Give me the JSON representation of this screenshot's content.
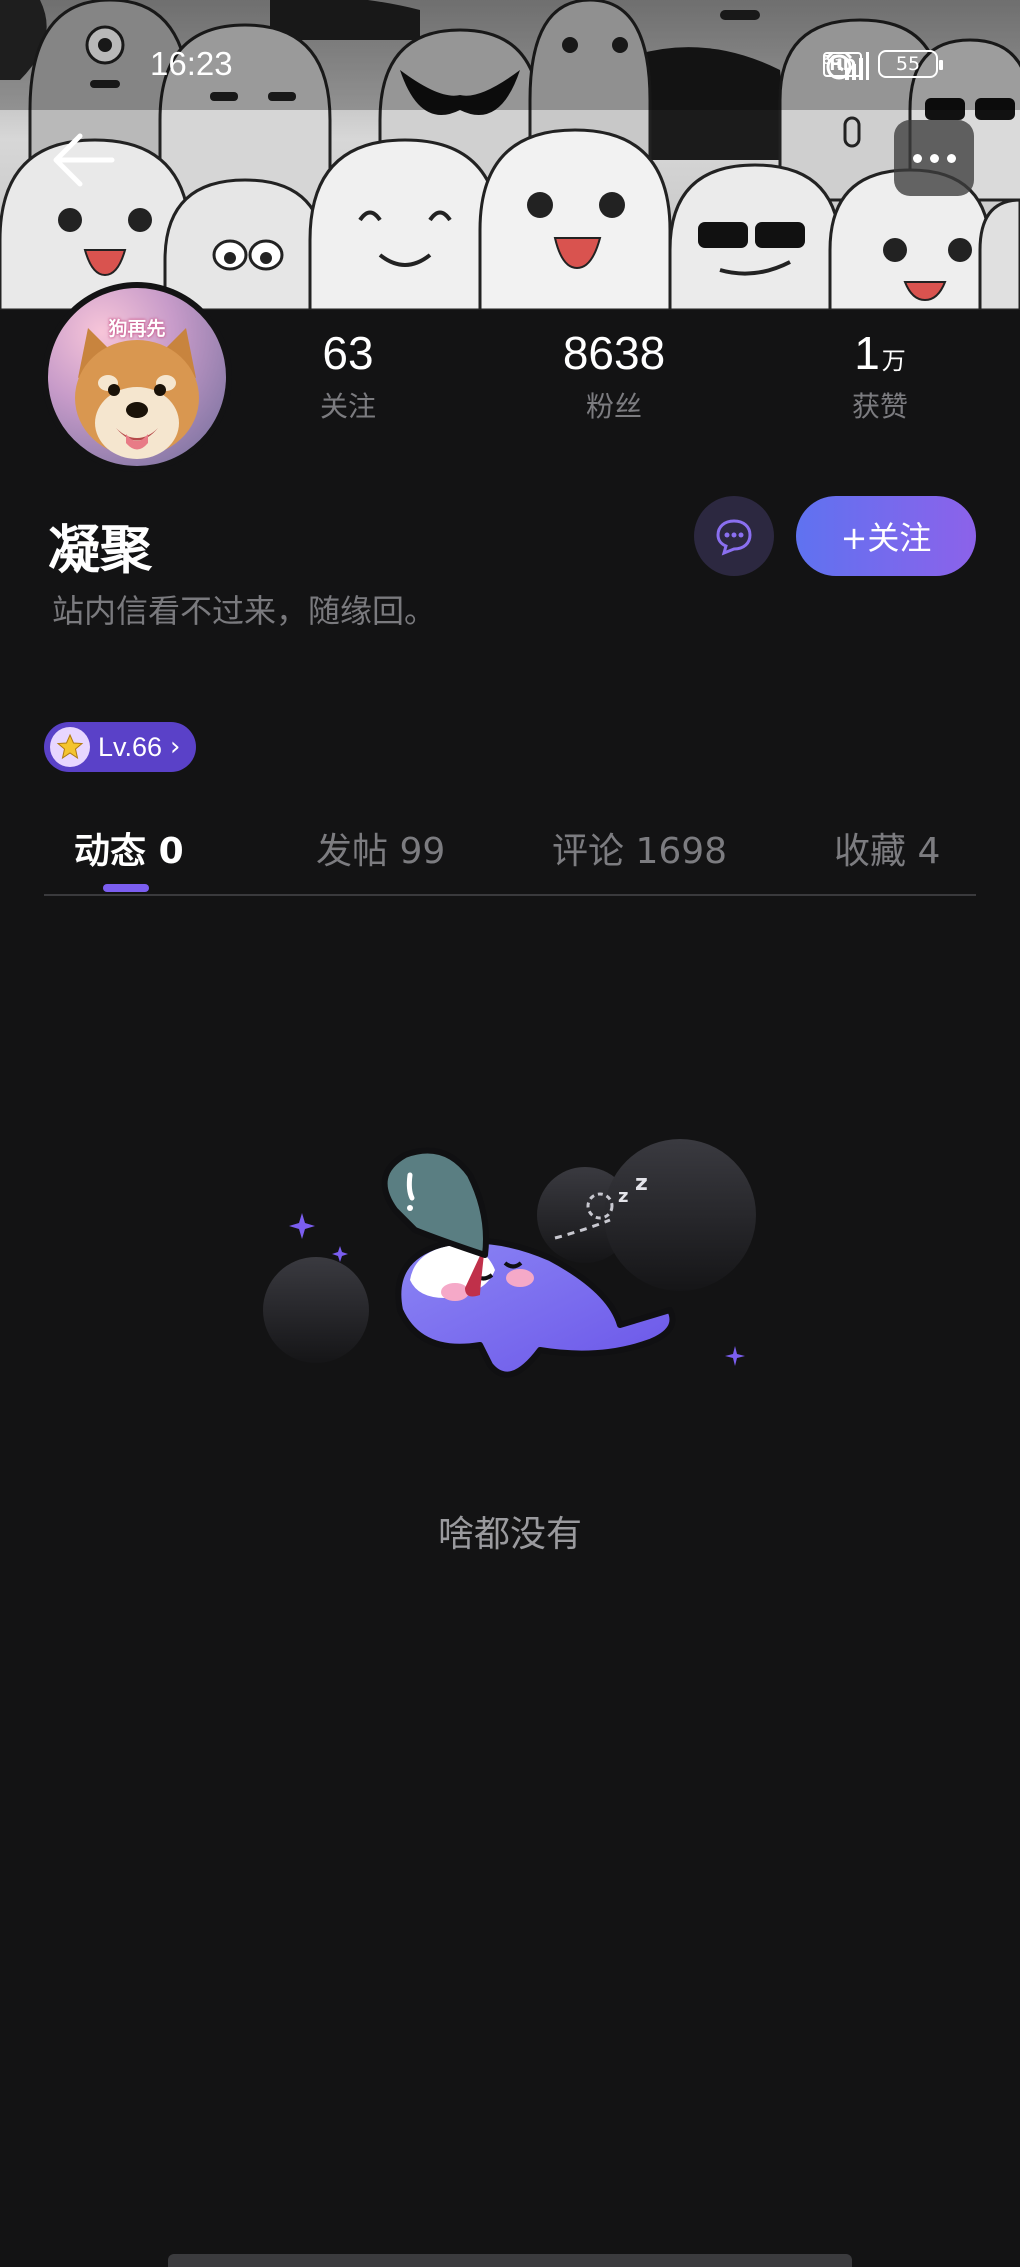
{
  "status_bar": {
    "time": "16:23",
    "network": "5G",
    "hd_label": "HD",
    "battery": "55",
    "icons": [
      "alarm-icon",
      "hd-icon",
      "signal-icon",
      "battery-icon"
    ]
  },
  "header": {
    "back_icon": "arrow-left-icon",
    "more_icon": "more-dots-icon"
  },
  "profile": {
    "avatar_logo_text": "狗再先",
    "name": "凝聚",
    "bio": "站内信看不过来，随缘回。",
    "stats": [
      {
        "value": "63",
        "unit": "",
        "label": "关注"
      },
      {
        "value": "8638",
        "unit": "",
        "label": "粉丝"
      },
      {
        "value": "1",
        "unit": "万",
        "label": "获赞"
      }
    ],
    "follow_label": "+关注",
    "level_label": "Lv.66"
  },
  "tabs": [
    {
      "label": "动态",
      "count": "0",
      "active": true
    },
    {
      "label": "发帖",
      "count": "99",
      "active": false
    },
    {
      "label": "评论",
      "count": "1698",
      "active": false
    },
    {
      "label": "收藏",
      "count": "4",
      "active": false
    }
  ],
  "empty_state": {
    "text": "啥都没有"
  },
  "colors": {
    "background": "#131314",
    "accent": "#7b5ef0",
    "follow_gradient_start": "#5f72f0",
    "follow_gradient_end": "#8c62ea",
    "muted_text": "#7c7c80"
  }
}
